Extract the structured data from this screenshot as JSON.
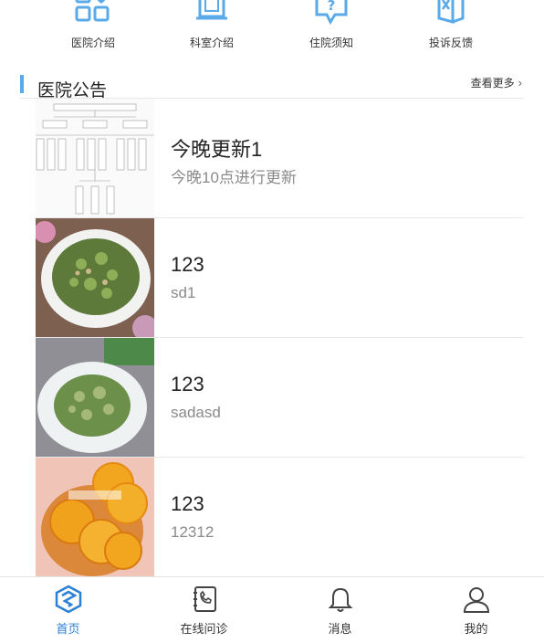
{
  "quick_nav": [
    {
      "label": "医院介绍",
      "icon": "grid-heart-icon"
    },
    {
      "label": "科室介绍",
      "icon": "door-icon"
    },
    {
      "label": "住院须知",
      "icon": "question-bubble-icon"
    },
    {
      "label": "投诉反馈",
      "icon": "complaint-book-icon"
    }
  ],
  "announcements": {
    "title": "医院公告",
    "more_label": "查看更多",
    "items": [
      {
        "title": "今晚更新1",
        "subtitle": "今晚10点进行更新",
        "thumb": "org-chart-image"
      },
      {
        "title": "123",
        "subtitle": "sd1",
        "thumb": "food-plate-image"
      },
      {
        "title": "123",
        "subtitle": "sadasd",
        "thumb": "food-plate-image"
      },
      {
        "title": "123",
        "subtitle": "12312",
        "thumb": "orange-slices-image"
      }
    ]
  },
  "tabbar": [
    {
      "label": "首页",
      "icon": "home-diamond-icon",
      "active": true
    },
    {
      "label": "在线问诊",
      "icon": "phone-book-icon",
      "active": false
    },
    {
      "label": "消息",
      "icon": "bell-icon",
      "active": false
    },
    {
      "label": "我的",
      "icon": "user-icon",
      "active": false
    }
  ],
  "colors": {
    "accent": "#2b7fd6",
    "icon_blue": "#5aa9e8",
    "divider": "#e6e6e6"
  }
}
